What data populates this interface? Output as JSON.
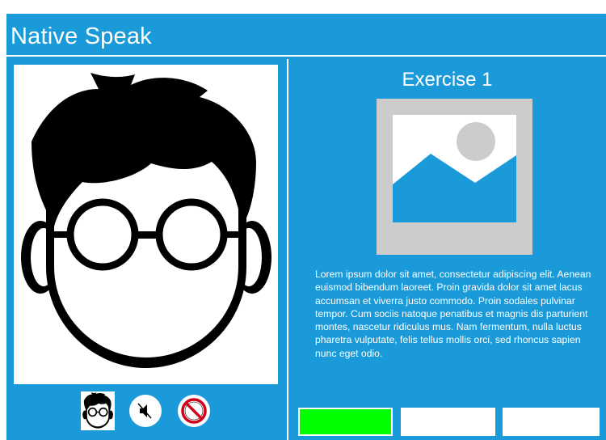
{
  "app": {
    "title": "Native Speak"
  },
  "exercise": {
    "title": "Exercise 1",
    "body": "Lorem ipsum dolor sit amet, consectetur adipiscing elit. Aenean euismod bibendum laoreet. Proin gravida dolor sit amet lacus accumsan et viverra justo commodo. Proin sodales pulvinar tempor. Cum sociis natoque penatibus et magnis dis parturient montes, nascetur ridiculus mus. Nam fermentum, nulla luctus pharetra vulputate, felis tellus mollis orci, sed rhoncus sapien nunc eget odio."
  },
  "controls": {
    "avatar_icon": "avatar-thumbnail-icon",
    "mute_icon": "speaker-muted-icon",
    "block_icon": "prohibited-icon"
  },
  "answers": [
    {
      "state": "correct",
      "color": "#00ff00"
    },
    {
      "state": "empty",
      "color": "#ffffff"
    },
    {
      "state": "empty",
      "color": "#ffffff"
    }
  ],
  "colors": {
    "primary": "#1a9ad9",
    "placeholder_frame": "#cccccc",
    "block_red": "#d0021b"
  }
}
